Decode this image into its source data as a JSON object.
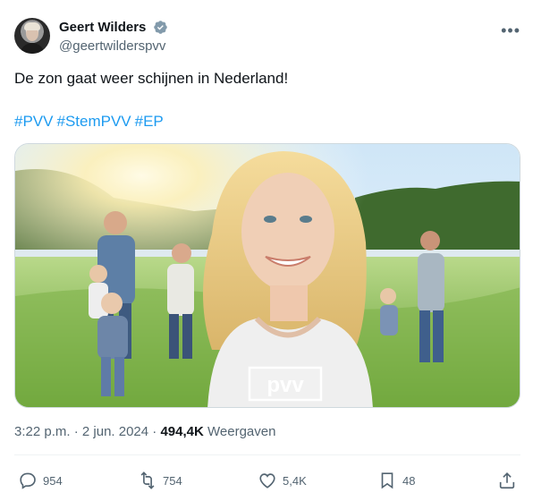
{
  "author": {
    "display_name": "Geert Wilders",
    "handle": "@geertwilderspvv",
    "verified_icon": "verified-badge-icon"
  },
  "tweet": {
    "text": "De zon gaat weer schijnen in Nederland!",
    "hashtags": [
      "#PVV",
      "#StemPVV",
      "#EP"
    ]
  },
  "media": {
    "logo_text": "pvv"
  },
  "meta": {
    "time": "3:22 p.m.",
    "separator": "·",
    "date": "2 jun. 2024",
    "views_count": "494,4K",
    "views_label": "Weergaven"
  },
  "actions": {
    "replies": "954",
    "reposts": "754",
    "likes": "5,4K",
    "bookmarks": "48"
  },
  "colors": {
    "link": "#1d9bf0",
    "muted": "#536471",
    "verified": "#829aab"
  }
}
